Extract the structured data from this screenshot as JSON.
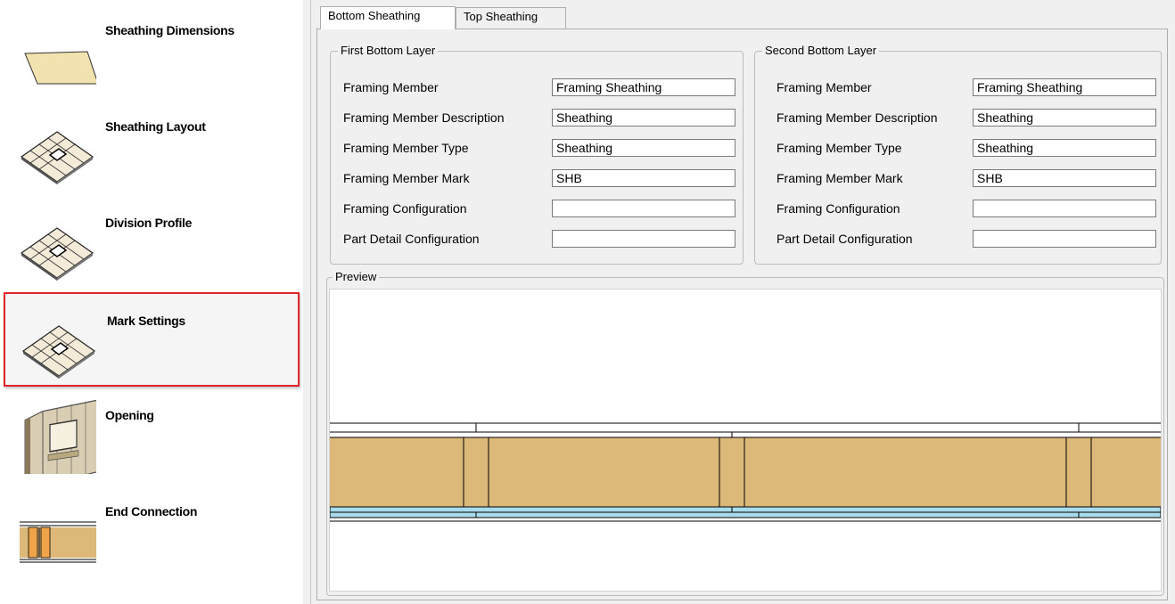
{
  "sidebar": {
    "items": [
      {
        "label": "Sheathing Dimensions",
        "icon": "sheathing-dimensions-icon",
        "selected": false
      },
      {
        "label": "Sheathing Layout",
        "icon": "sheathing-layout-icon",
        "selected": false
      },
      {
        "label": "Division Profile",
        "icon": "division-profile-icon",
        "selected": false
      },
      {
        "label": "Mark Settings",
        "icon": "mark-settings-icon",
        "selected": true
      },
      {
        "label": "Opening",
        "icon": "opening-icon",
        "selected": false
      },
      {
        "label": "End Connection",
        "icon": "end-connection-icon",
        "selected": false
      }
    ]
  },
  "tabs": [
    {
      "label": "Bottom Sheathing",
      "active": true
    },
    {
      "label": "Top Sheathing",
      "active": false
    }
  ],
  "first_layer": {
    "title": "First Bottom Layer",
    "fields": [
      {
        "label": "Framing Member",
        "value": "Framing Sheathing"
      },
      {
        "label": "Framing Member Description",
        "value": "Sheathing"
      },
      {
        "label": "Framing Member Type",
        "value": "Sheathing"
      },
      {
        "label": "Framing Member Mark",
        "value": "SHB"
      },
      {
        "label": "Framing Configuration",
        "value": ""
      },
      {
        "label": "Part Detail Configuration",
        "value": ""
      }
    ]
  },
  "second_layer": {
    "title": "Second Bottom Layer",
    "fields": [
      {
        "label": "Framing Member",
        "value": "Framing Sheathing"
      },
      {
        "label": "Framing Member Description",
        "value": "Sheathing"
      },
      {
        "label": "Framing Member Type",
        "value": "Sheathing"
      },
      {
        "label": "Framing Member Mark",
        "value": "SHB"
      },
      {
        "label": "Framing Configuration",
        "value": ""
      },
      {
        "label": "Part Detail Configuration",
        "value": ""
      }
    ]
  },
  "preview": {
    "title": "Preview"
  },
  "colors": {
    "selection_border": "#e2222a",
    "wood": "#dcb978",
    "blue_layer": "#a8dcec"
  }
}
